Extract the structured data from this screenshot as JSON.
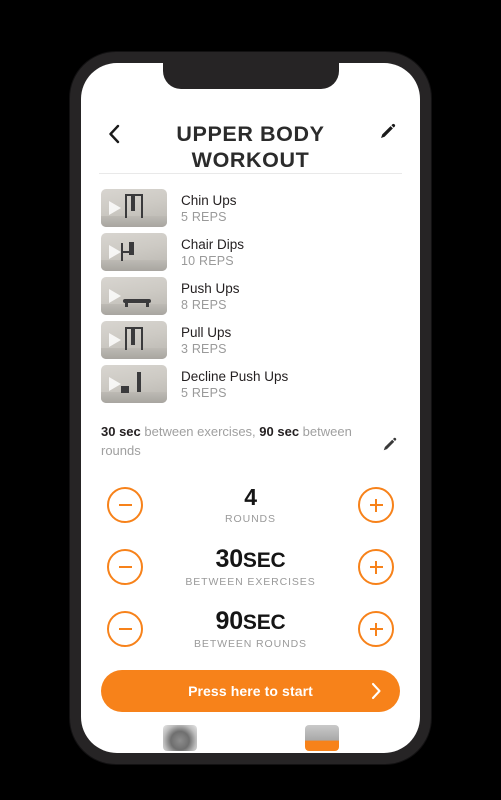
{
  "app": {
    "accent_color": "#F7821A",
    "title": "UPPER BODY WORKOUT",
    "back_icon": "chevron-left-icon",
    "edit_icon": "pencil-icon"
  },
  "exercises": [
    {
      "name": "Chin Ups",
      "reps": "5 REPS",
      "thumb_icon": "video-thumbnail",
      "play_icon": "play-icon"
    },
    {
      "name": "Chair Dips",
      "reps": "10 REPS",
      "thumb_icon": "video-thumbnail",
      "play_icon": "play-icon"
    },
    {
      "name": "Push Ups",
      "reps": "8 REPS",
      "thumb_icon": "video-thumbnail",
      "play_icon": "play-icon"
    },
    {
      "name": "Pull Ups",
      "reps": "3 REPS",
      "thumb_icon": "video-thumbnail",
      "play_icon": "play-icon"
    },
    {
      "name": "Decline Push Ups",
      "reps": "5 REPS",
      "thumb_icon": "video-thumbnail",
      "play_icon": "play-icon"
    }
  ],
  "rest_summary": {
    "exercise_rest": "30 sec",
    "middle_text": " between exercises, ",
    "round_rest": "90 sec",
    "tail_text": " between rounds",
    "edit_icon": "pencil-icon"
  },
  "steppers": [
    {
      "value": "4",
      "unit": "",
      "label": "ROUNDS",
      "decrement_icon": "minus-icon",
      "increment_icon": "plus-icon"
    },
    {
      "value": "30",
      "unit": "SEC",
      "label": "BETWEEN EXERCISES",
      "decrement_icon": "minus-icon",
      "increment_icon": "plus-icon"
    },
    {
      "value": "90",
      "unit": "SEC",
      "label": "BETWEEN ROUNDS",
      "decrement_icon": "minus-icon",
      "increment_icon": "plus-icon"
    }
  ],
  "cta": {
    "label": "Press here to start",
    "chevron_icon": "chevron-right-icon"
  }
}
